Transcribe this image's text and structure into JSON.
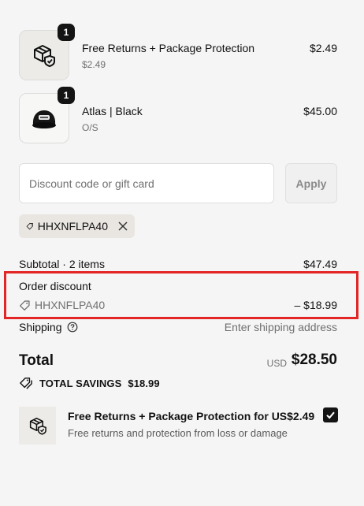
{
  "line_items": [
    {
      "name": "Free Returns + Package Protection",
      "subtitle": "$2.49",
      "price": "$2.49",
      "quantity": "1",
      "icon": "package-shield-icon"
    },
    {
      "name": "Atlas | Black",
      "subtitle": "O/S",
      "price": "$45.00",
      "quantity": "1",
      "icon": "black-cap-image"
    }
  ],
  "discount": {
    "placeholder": "Discount code or gift card",
    "value": "",
    "apply_label": "Apply",
    "applied_code": "HHXNFLPA40"
  },
  "summary": {
    "subtotal_label": "Subtotal · 2 items",
    "subtotal_value": "$47.49",
    "order_discount_label": "Order discount",
    "discount_code": "HHXNFLPA40",
    "discount_value": "– $18.99",
    "shipping_label": "Shipping",
    "shipping_value": "Enter shipping address",
    "total_label": "Total",
    "currency": "USD",
    "total_value": "$28.50",
    "savings_label": "TOTAL SAVINGS",
    "savings_value": "$18.99"
  },
  "upsell": {
    "title": "Free Returns + Package Protection for US$2.49",
    "description": "Free returns and protection from loss or damage",
    "checked": true
  },
  "colors": {
    "background": "#f5f5f5",
    "highlight_border": "#e22525",
    "badge": "#141414"
  }
}
